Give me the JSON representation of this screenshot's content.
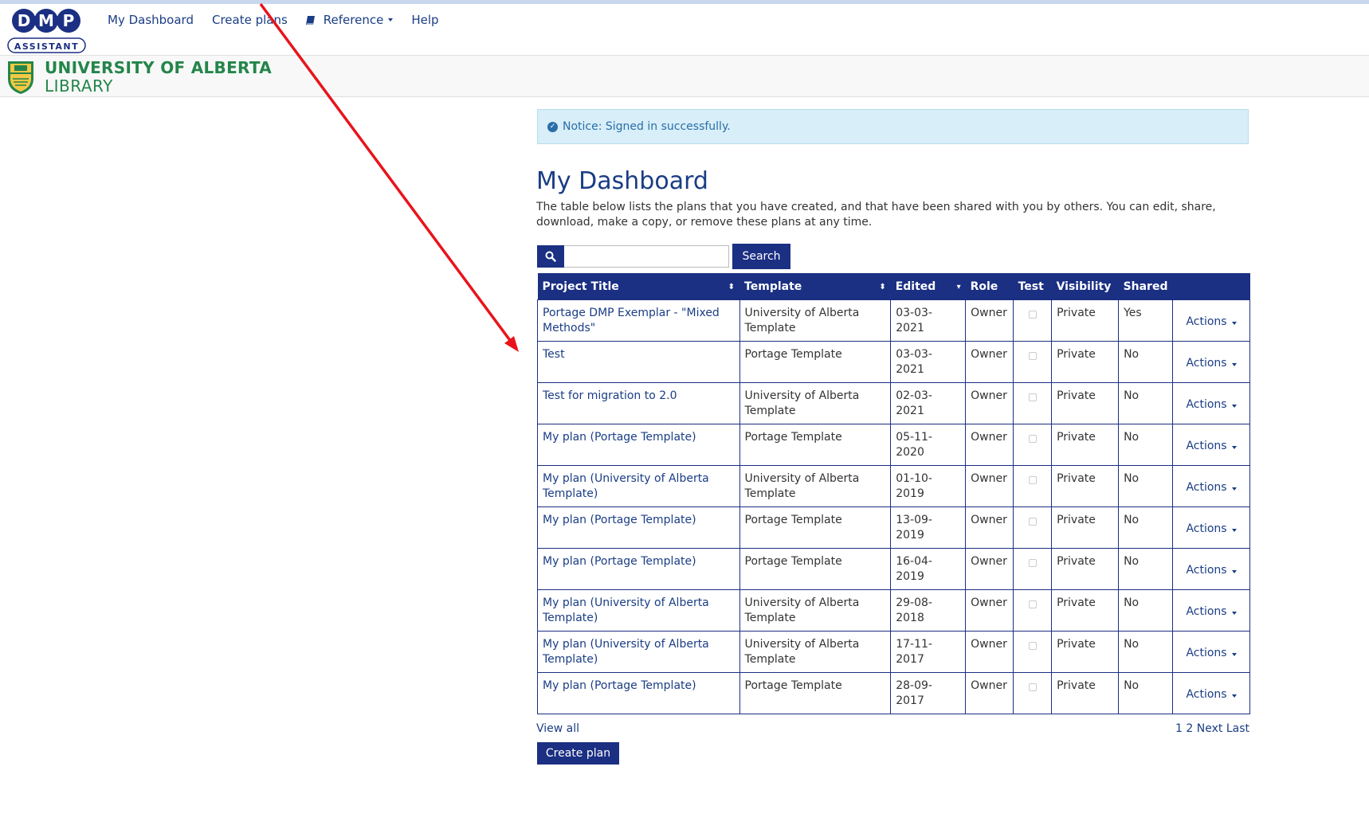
{
  "nav": {
    "logo_text": "DMP",
    "logo_sub": "ASSISTANT",
    "links": [
      "My Dashboard",
      "Create plans",
      "Reference",
      "Help"
    ],
    "reference_icon": "book-icon"
  },
  "brand": {
    "line1": "UNIVERSITY OF ALBERTA",
    "line2": "LIBRARY",
    "color": "#24854a"
  },
  "notice": {
    "text": "Notice: Signed in successfully.",
    "icon": "check-circle-icon"
  },
  "page": {
    "title": "My Dashboard",
    "intro": "The table below lists the plans that you have created, and that have been shared with you by others. You can edit, share, download, make a copy, or remove these plans at any time."
  },
  "search": {
    "placeholder": "",
    "button": "Search",
    "icon": "search-icon"
  },
  "table": {
    "headers": [
      "Project Title",
      "Template",
      "Edited",
      "Role",
      "Test",
      "Visibility",
      "Shared",
      ""
    ],
    "rows": [
      {
        "title": "Portage DMP Exemplar - \"Mixed Methods\"",
        "template": "University of Alberta Template",
        "edited": "03-03-2021",
        "role": "Owner",
        "visibility": "Private",
        "shared": "Yes",
        "actions": "Actions"
      },
      {
        "title": "Test",
        "template": "Portage Template",
        "edited": "03-03-2021",
        "role": "Owner",
        "visibility": "Private",
        "shared": "No",
        "actions": "Actions"
      },
      {
        "title": "Test for migration to 2.0",
        "template": "University of Alberta Template",
        "edited": "02-03-2021",
        "role": "Owner",
        "visibility": "Private",
        "shared": "No",
        "actions": "Actions"
      },
      {
        "title": "My plan (Portage Template)",
        "template": "Portage Template",
        "edited": "05-11-2020",
        "role": "Owner",
        "visibility": "Private",
        "shared": "No",
        "actions": "Actions"
      },
      {
        "title": "My plan (University of Alberta Template)",
        "template": "University of Alberta Template",
        "edited": "01-10-2019",
        "role": "Owner",
        "visibility": "Private",
        "shared": "No",
        "actions": "Actions"
      },
      {
        "title": "My plan (Portage Template)",
        "template": "Portage Template",
        "edited": "13-09-2019",
        "role": "Owner",
        "visibility": "Private",
        "shared": "No",
        "actions": "Actions"
      },
      {
        "title": "My plan (Portage Template)",
        "template": "Portage Template",
        "edited": "16-04-2019",
        "role": "Owner",
        "visibility": "Private",
        "shared": "No",
        "actions": "Actions"
      },
      {
        "title": "My plan (University of Alberta Template)",
        "template": "University of Alberta Template",
        "edited": "29-08-2018",
        "role": "Owner",
        "visibility": "Private",
        "shared": "No",
        "actions": "Actions"
      },
      {
        "title": "My plan (University of Alberta Template)",
        "template": "University of Alberta Template",
        "edited": "17-11-2017",
        "role": "Owner",
        "visibility": "Private",
        "shared": "No",
        "actions": "Actions"
      },
      {
        "title": "My plan (Portage Template)",
        "template": "Portage Template",
        "edited": "28-09-2017",
        "role": "Owner",
        "visibility": "Private",
        "shared": "No",
        "actions": "Actions"
      }
    ]
  },
  "footer": {
    "view_all": "View all",
    "pagination": "1 2 Next Last",
    "create_plan": "Create plan"
  },
  "colors": {
    "primary": "#1b2f83",
    "link": "#1a3d85",
    "notice_bg": "#d8eef8",
    "annotation_arrow": "#e8141c"
  }
}
